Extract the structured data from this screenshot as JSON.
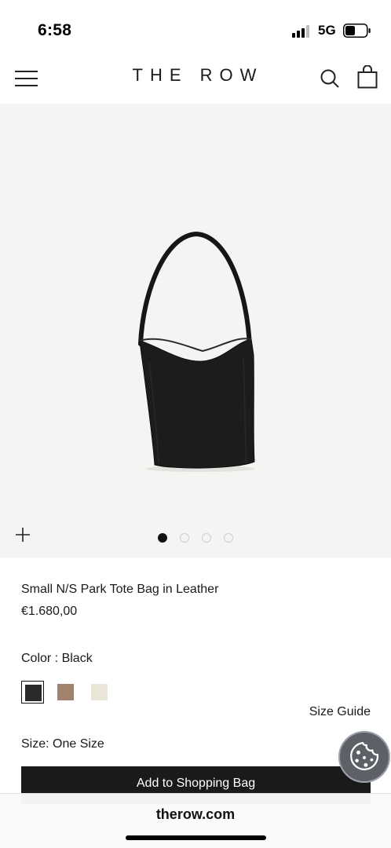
{
  "status_bar": {
    "time": "6:58",
    "network": "5G",
    "signal_bars_active": 3,
    "battery_level": 0.4
  },
  "header": {
    "brand": "THE ROW",
    "menu_icon": "hamburger-menu-icon",
    "search_icon": "search-icon",
    "bag_icon": "shopping-bag-icon"
  },
  "gallery": {
    "image_count": 4,
    "active_index": 0,
    "zoom_icon": "plus-icon",
    "background": "#f5f4f2"
  },
  "product": {
    "name": "Small N/S Park Tote Bag in Leather",
    "price": "€1.680,00",
    "color_label": "Color : Black",
    "swatches": [
      {
        "name": "Black",
        "color": "#2a2a2a",
        "selected": true
      },
      {
        "name": "Taupe",
        "color": "#a2826c",
        "selected": false
      },
      {
        "name": "Ivory",
        "color": "#e9e6d8",
        "selected": false
      }
    ],
    "size_guide": "Size Guide",
    "size_label": "Size: One Size",
    "add_button": "Add to Shopping Bag"
  },
  "cookie": {
    "icon": "cookie-icon"
  },
  "browser": {
    "address": "therow.com"
  },
  "colors": {
    "button_bg": "#1a1a1a",
    "cookie_bg": "#5e6068"
  }
}
